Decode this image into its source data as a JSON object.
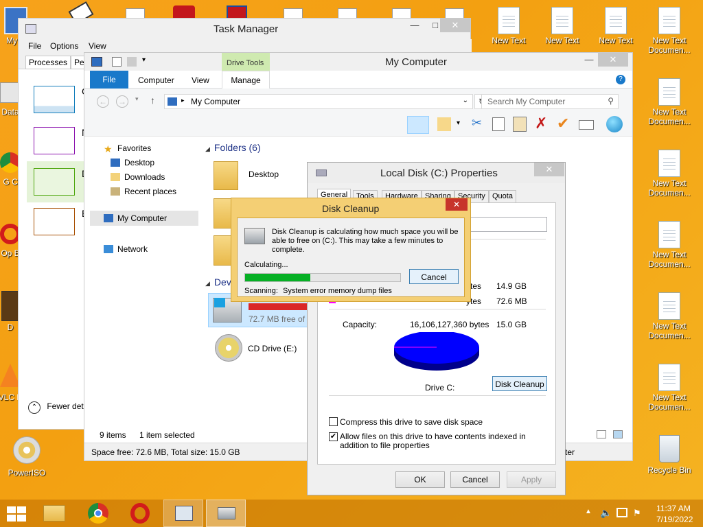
{
  "desktop": {
    "left_icons": [
      "My C",
      "Data",
      "G C",
      "Op B",
      "D",
      "VLC P",
      "PowerISO"
    ],
    "right_icons": [
      "New Text",
      "New Text",
      "New Text",
      "New Text Documen...",
      "New Text Documen...",
      "New Text Documen...",
      "New Text Documen...",
      "New Text Documen...",
      "New Text Documen...",
      "Recycle Bin"
    ]
  },
  "task_manager": {
    "title": "Task Manager",
    "menu": [
      "File",
      "Options",
      "View"
    ],
    "tabs": [
      "Processes",
      "Per"
    ],
    "perf_items": [
      "C",
      "N",
      "D",
      "E"
    ],
    "fewer_details": "Fewer deta"
  },
  "explorer": {
    "title": "My Computer",
    "contextual_tab": "Drive Tools",
    "ribbon_tabs": [
      "File",
      "Computer",
      "View",
      "Manage"
    ],
    "address": "My Computer",
    "search_placeholder": "Search My Computer",
    "nav": {
      "favorites": "Favorites",
      "desktop": "Desktop",
      "downloads": "Downloads",
      "recent": "Recent places",
      "my_computer": "My Computer",
      "network": "Network"
    },
    "folders_header": "Folders (6)",
    "folder_desktop": "Desktop",
    "devices_header": "Devi",
    "drive_free": "72.7 MB free of 1",
    "cd_drive": "CD Drive (E:)",
    "status_items": "9 items",
    "status_selected": "1 item selected",
    "space_free": "Space free: 72.6 MB, Total size: 15.0 GB",
    "status_right": "ter"
  },
  "properties": {
    "title": "Local Disk (C:) Properties",
    "tabs": [
      "General",
      "Tools",
      "Hardware",
      "Sharing",
      "Security",
      "Quota"
    ],
    "used_gb": "14.9 GB",
    "free_bytes_suffix": "ytes",
    "free_gb": "72.6 MB",
    "capacity_label": "Capacity:",
    "capacity_bytes": "16,106,127,360 bytes",
    "capacity_gb": "15.0 GB",
    "drive_label": "Drive C:",
    "disk_cleanup_button": "Disk Cleanup",
    "compress_label": "Compress this drive to save disk space",
    "compress_checked": false,
    "index_label": "Allow files on this drive to have contents indexed in addition to file properties",
    "index_checked": true,
    "ok": "OK",
    "cancel": "Cancel",
    "apply": "Apply"
  },
  "disk_cleanup": {
    "title": "Disk Cleanup",
    "message": "Disk Cleanup is calculating how much space you will be able to free on  (C:). This may take a few minutes to complete.",
    "calculating": "Calculating...",
    "cancel": "Cancel",
    "progress": 0.42,
    "scanning_label": "Scanning:",
    "scanning_item": "System error memory dump files"
  },
  "taskbar": {
    "time": "11:37 AM",
    "date": "7/19/2022"
  },
  "colors": {
    "accent": "#1979ca",
    "progress": "#06b025",
    "pie_used": "#0000ff",
    "drive_bar": "#da2626"
  }
}
